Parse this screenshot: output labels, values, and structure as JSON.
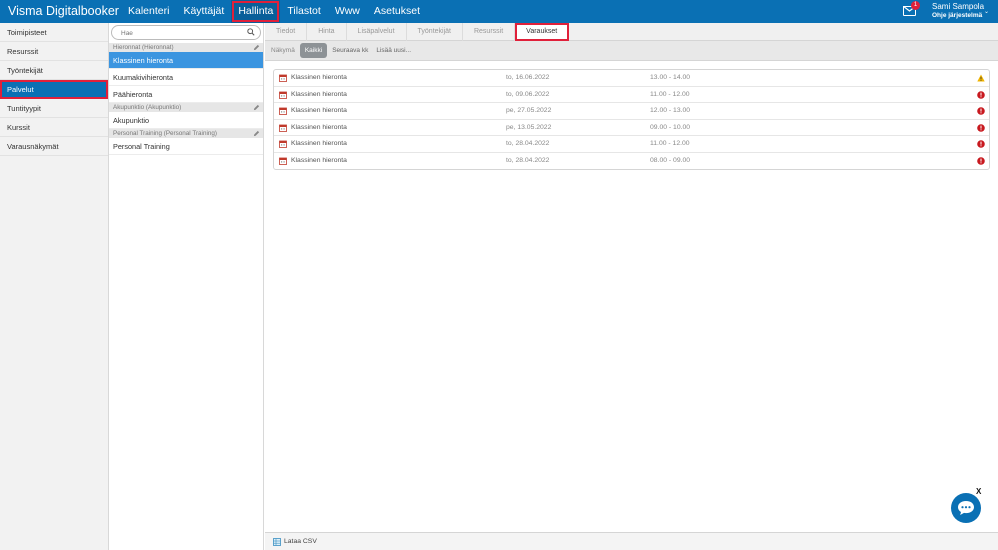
{
  "app": {
    "brand": "Visma Digitalbooker"
  },
  "nav": {
    "items": [
      {
        "label": "Kalenteri"
      },
      {
        "label": "Käyttäjät"
      },
      {
        "label": "Hallinta"
      },
      {
        "label": "Tilastot"
      },
      {
        "label": "Www"
      },
      {
        "label": "Asetukset"
      }
    ],
    "active": "Hallinta"
  },
  "header": {
    "notifications_count": "1",
    "user_name": "Sami Sampola",
    "help_link": "Ohje järjestelmä"
  },
  "sidebar": {
    "items": [
      {
        "label": "Toimipisteet"
      },
      {
        "label": "Resurssit"
      },
      {
        "label": "Työntekijät"
      },
      {
        "label": "Palvelut"
      },
      {
        "label": "Tuntityypit"
      },
      {
        "label": "Kurssit"
      },
      {
        "label": "Varausnäkymät"
      }
    ],
    "active": "Palvelut"
  },
  "services": {
    "search_placeholder": "Hae",
    "groups": [
      {
        "header": "Hieronnat (Hieronnat)",
        "items": [
          "Klassinen hieronta",
          "Kuumakivihieronta",
          "Päähieronta"
        ]
      },
      {
        "header": "Akupunktio (Akupunktio)",
        "items": [
          "Akupunktio"
        ]
      },
      {
        "header": "Personal Training (Personal Training)",
        "items": [
          "Personal Training"
        ]
      }
    ],
    "active": "Klassinen hieronta"
  },
  "tabs": {
    "items": [
      {
        "label": "Tiedot"
      },
      {
        "label": "Hinta"
      },
      {
        "label": "Lisäpalvelut"
      },
      {
        "label": "Työntekijät"
      },
      {
        "label": "Resurssit"
      },
      {
        "label": "Varaukset"
      }
    ],
    "active": "Varaukset"
  },
  "filter": {
    "label": "Näkymä",
    "buttons": [
      {
        "label": "Kaikki"
      },
      {
        "label": "Seuraava kk"
      },
      {
        "label": "Lisää uusi..."
      }
    ],
    "active": "Kaikki"
  },
  "bookings": [
    {
      "service": "Klassinen hieronta",
      "date": "to, 16.06.2022",
      "time": "13.00 - 14.00",
      "status": "warning-icon"
    },
    {
      "service": "Klassinen hieronta",
      "date": "to, 09.06.2022",
      "time": "11.00 - 12.00",
      "status": "error-icon"
    },
    {
      "service": "Klassinen hieronta",
      "date": "pe, 27.05.2022",
      "time": "12.00 - 13.00",
      "status": "error-icon"
    },
    {
      "service": "Klassinen hieronta",
      "date": "pe, 13.05.2022",
      "time": "09.00 - 10.00",
      "status": "error-icon"
    },
    {
      "service": "Klassinen hieronta",
      "date": "to, 28.04.2022",
      "time": "11.00 - 12.00",
      "status": "error-icon"
    },
    {
      "service": "Klassinen hieronta",
      "date": "to, 28.04.2022",
      "time": "08.00 - 09.00",
      "status": "error-icon"
    }
  ],
  "footer": {
    "csv_label": "Lataa CSV"
  },
  "chat": {
    "close": "X"
  },
  "colors": {
    "brand_blue": "#0a70b4",
    "highlight_red": "#e0203a",
    "active_service": "#3b95e0",
    "error_red": "#c8191f",
    "warning_yellow": "#f0b400"
  }
}
